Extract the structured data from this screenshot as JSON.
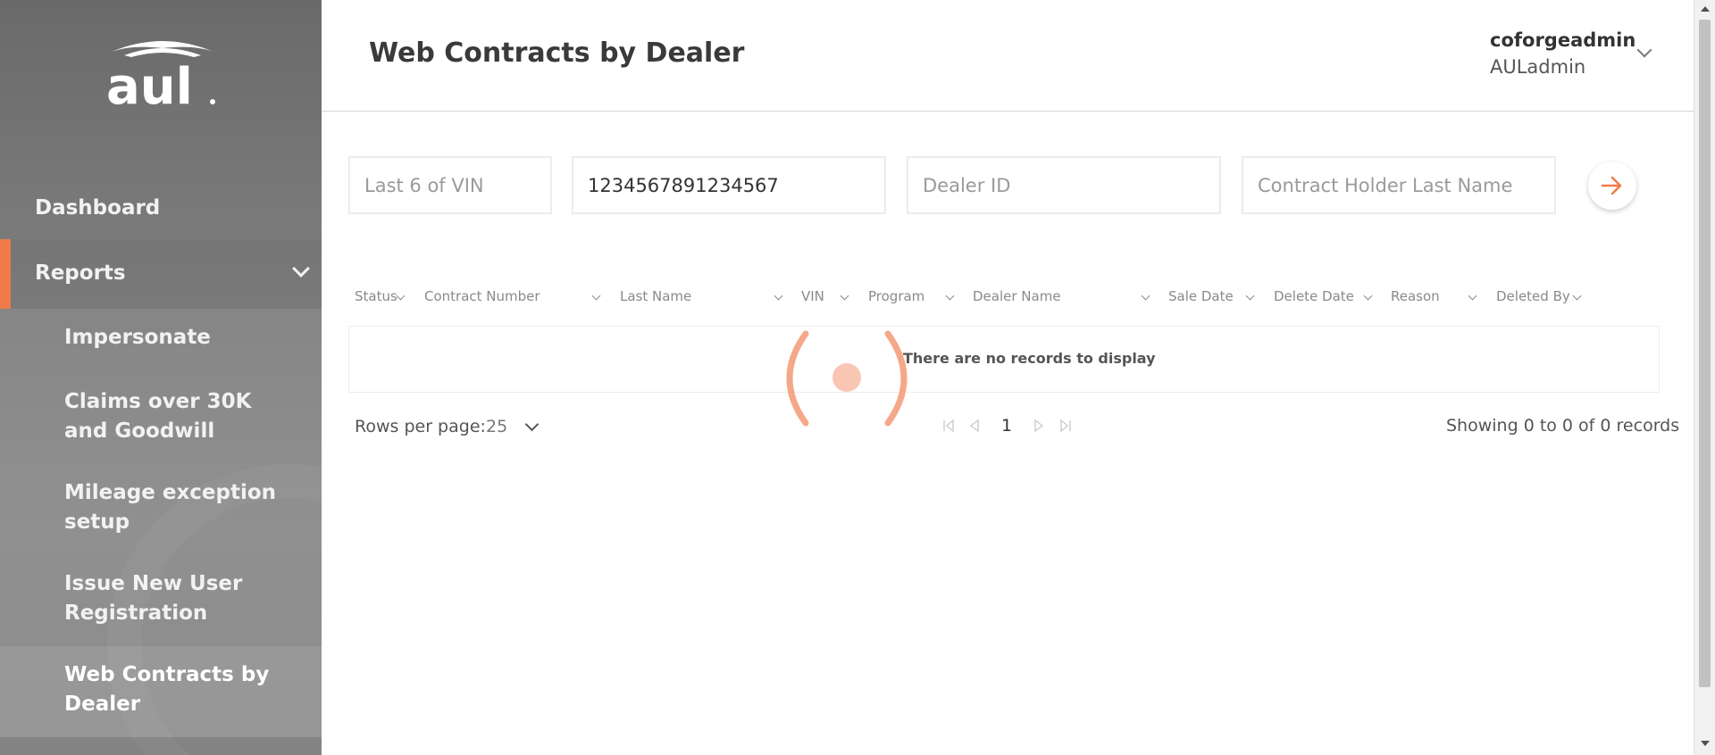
{
  "brand": {
    "logo_text": "aul",
    "accent_color": "#f07a4a"
  },
  "sidebar": {
    "items": [
      {
        "label": "Dashboard"
      },
      {
        "label": "Reports",
        "expanded": true
      },
      {
        "label": "Impersonate"
      },
      {
        "label": "Claims over 30K and Goodwill"
      },
      {
        "label": "Mileage exception setup"
      },
      {
        "label": "Issue New User Registration"
      },
      {
        "label": "Web Contracts by Dealer",
        "selected": true
      }
    ]
  },
  "header": {
    "title": "Web Contracts by Dealer",
    "user_name": "coforgeadmin",
    "user_role": "AULadmin"
  },
  "filters": {
    "vin_placeholder": "Last 6 of VIN",
    "vin_full_value": "1234567891234567",
    "dealer_id_placeholder": "Dealer ID",
    "last_name_placeholder": "Contract Holder Last Name"
  },
  "table": {
    "columns": [
      "Status",
      "Contract Number",
      "Last Name",
      "VIN",
      "Program",
      "Dealer Name",
      "Sale Date",
      "Delete Date",
      "Reason",
      "Deleted By"
    ],
    "empty_message": "There are no records to display"
  },
  "pagination": {
    "rows_per_page_label": "Rows per page:",
    "rows_per_page_value": "25",
    "current_page": "1",
    "showing_text": "Showing 0 to 0 of 0 records"
  },
  "loading": true
}
